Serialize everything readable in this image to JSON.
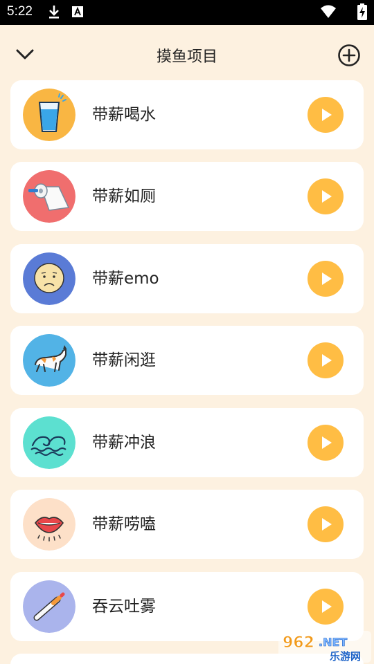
{
  "status_bar": {
    "time": "5:22",
    "icons": [
      "download-icon",
      "accessibility-a-icon",
      "wifi-icon",
      "battery-charging-icon"
    ]
  },
  "header": {
    "title": "摸鱼项目",
    "back_icon": "chevron-down-icon",
    "add_icon": "add-circle-icon"
  },
  "items": [
    {
      "label": "带薪喝水",
      "icon": "water-glass-icon",
      "bg": "#f9b643"
    },
    {
      "label": "带薪如厕",
      "icon": "toilet-paper-icon",
      "bg": "#f06e6e"
    },
    {
      "label": "带薪emo",
      "icon": "sad-face-icon",
      "bg": "#5a7bd6"
    },
    {
      "label": "带薪闲逛",
      "icon": "walking-cat-icon",
      "bg": "#52b3e6"
    },
    {
      "label": "带薪冲浪",
      "icon": "wave-icon",
      "bg": "#5ce0d0"
    },
    {
      "label": "带薪唠嗑",
      "icon": "lips-icon",
      "bg": "#fde0c8"
    },
    {
      "label": "吞云吐雾",
      "icon": "cigarette-icon",
      "bg": "#aab4ec"
    }
  ],
  "colors": {
    "page_bg": "#fdf1e0",
    "card_bg": "#ffffff",
    "play_button": "#ffbd44"
  },
  "watermark": {
    "top_text": "962.NET",
    "bottom_text": "乐游网"
  }
}
